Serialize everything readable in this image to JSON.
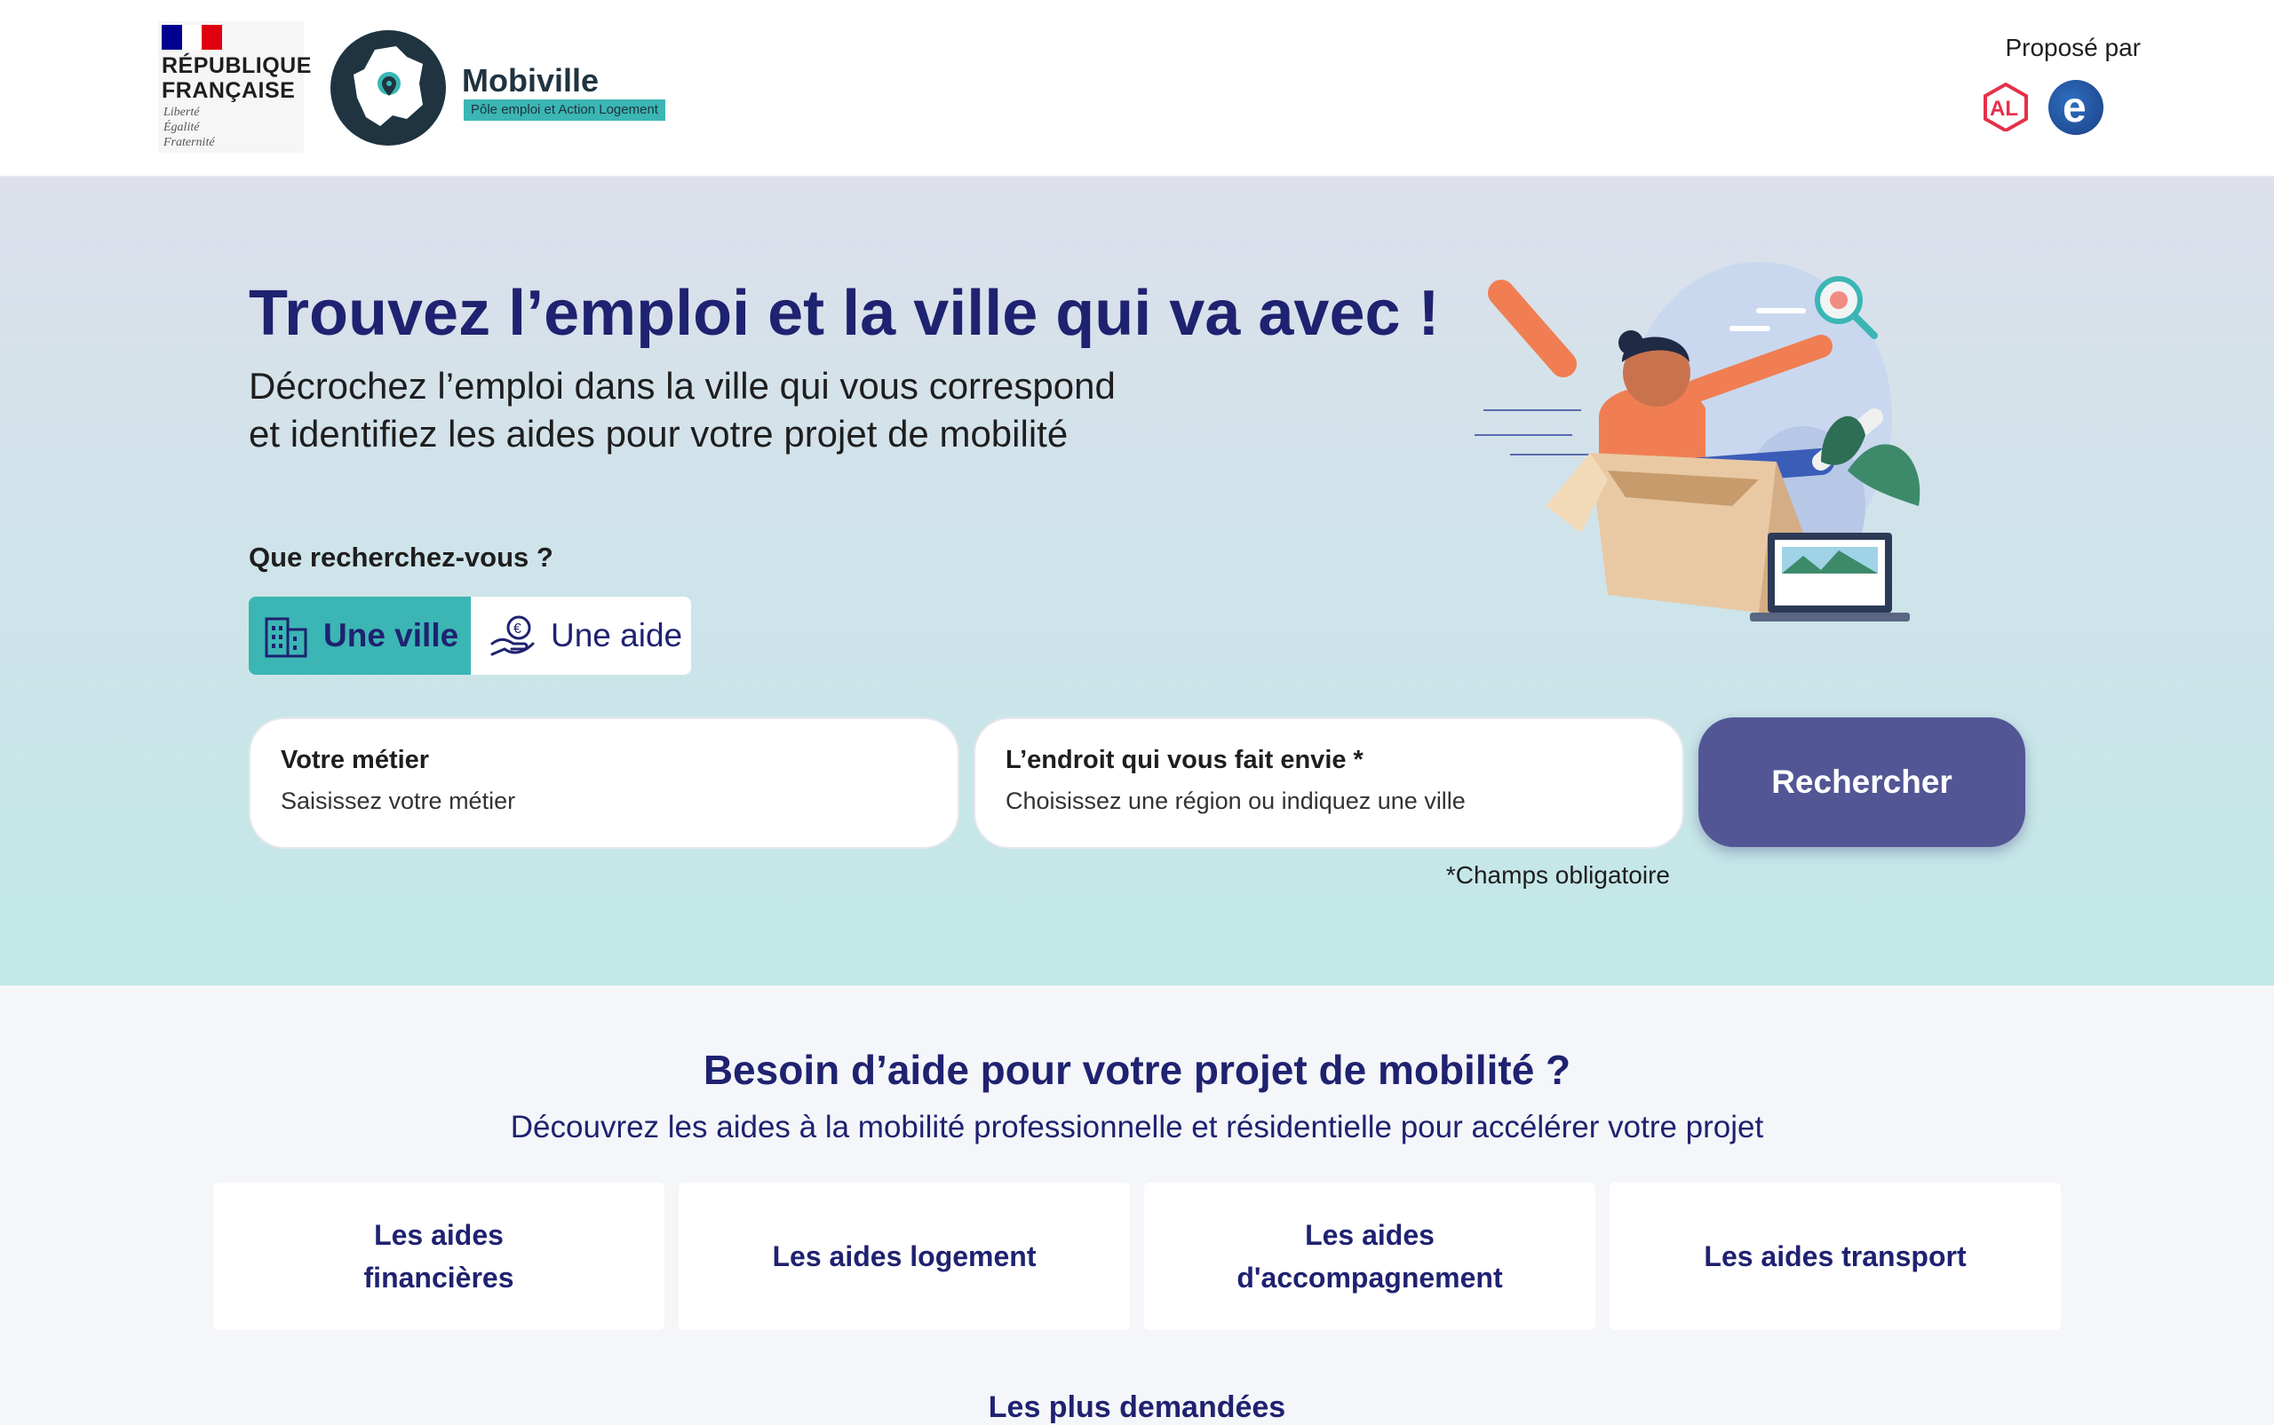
{
  "header": {
    "republique": {
      "line1": "RÉPUBLIQUE",
      "line2": "FRANÇAISE",
      "motto1": "Liberté",
      "motto2": "Égalité",
      "motto3": "Fraternité"
    },
    "brand": {
      "title": "Mobiville",
      "subtitle": "Pôle emploi et Action Logement"
    },
    "proposed_by": "Proposé par",
    "partner_logos": [
      "action-logement-logo",
      "pole-emploi-logo"
    ]
  },
  "hero": {
    "title": "Trouvez l’emploi et la ville qui va avec !",
    "subtitle_line1": "Décrochez l’emploi dans la ville qui vous correspond",
    "subtitle_line2": "et identifiez les aides pour votre projet de mobilité",
    "question": "Que recherchez-vous ?",
    "toggle": {
      "city_label": "Une ville",
      "aid_label": "Une aide",
      "selected": "Une ville"
    },
    "search": {
      "job_label": "Votre métier",
      "job_placeholder": "Saisissez votre métier",
      "place_label": "L’endroit qui vous fait envie *",
      "place_placeholder": "Choisissez une région ou indiquez une ville",
      "button": "Rechercher",
      "mandatory_note": "*Champs obligatoire"
    }
  },
  "aids": {
    "title": "Besoin d’aide pour votre projet de mobilité ?",
    "subtitle": "Découvrez les aides à la mobilité professionnelle et résidentielle pour accélérer votre projet",
    "cards": [
      "Les aides financières",
      "Les aides logement",
      "Les aides d'accompagnement",
      "Les aides transport"
    ],
    "popular_title": "Les plus demandées"
  },
  "colors": {
    "brand_navy": "#1f2270",
    "teal": "#3bb6b4",
    "button": "#535694"
  }
}
